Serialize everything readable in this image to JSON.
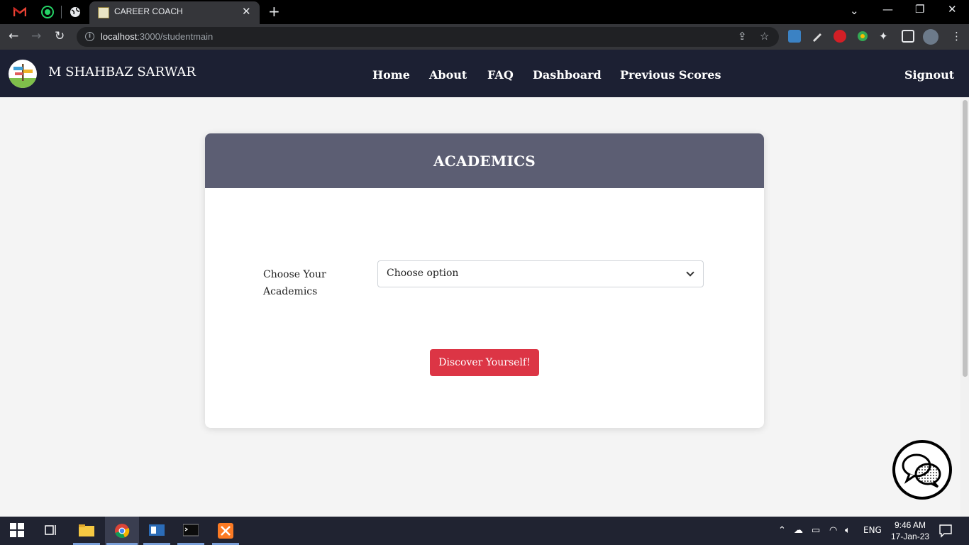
{
  "browser": {
    "tab_title": "CAREER COACH",
    "url_host": "localhost",
    "url_path": ":3000/studentmain"
  },
  "navbar": {
    "brand": "M SHAHBAZ SARWAR",
    "links": [
      "Home",
      "About",
      "FAQ",
      "Dashboard",
      "Previous Scores"
    ],
    "signout": "Signout"
  },
  "card": {
    "title": "ACADEMICS",
    "field_label": "Choose Your Academics",
    "select_value": "Choose option",
    "button": "Discover Yourself!"
  },
  "taskbar": {
    "language": "ENG",
    "time": "9:46 AM",
    "date": "17-Jan-23"
  },
  "colors": {
    "navbar_bg": "#1c2033",
    "card_header": "#5c5e73",
    "button_red": "#dc3545"
  }
}
